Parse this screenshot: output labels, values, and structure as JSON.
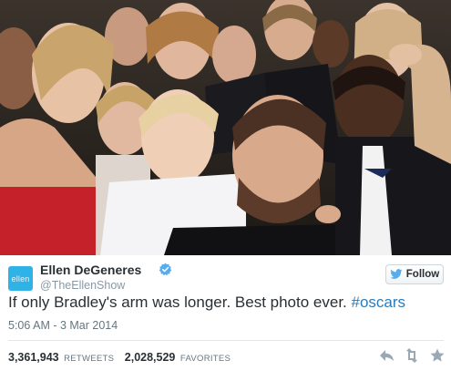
{
  "tweet": {
    "author_name": "Ellen DeGeneres",
    "author_handle": "@TheEllenShow",
    "avatar_text": "ellen",
    "verified": true,
    "follow_label": "Follow",
    "text": "If only Bradley's arm was longer. Best photo ever.",
    "hashtag": "#oscars",
    "timestamp": "5:06 AM - 3 Mar 2014",
    "retweets_count": "3,361,943",
    "retweets_label": "RETWEETS",
    "favorites_count": "2,028,529",
    "favorites_label": "FAVORITES"
  },
  "colors": {
    "link": "#2b7bb9",
    "avatar": "#2fb2e6",
    "muted": "#8899a6"
  },
  "icons": [
    "verified-badge-icon",
    "twitter-bird-icon",
    "reply-icon",
    "retweet-icon",
    "favorite-star-icon"
  ]
}
